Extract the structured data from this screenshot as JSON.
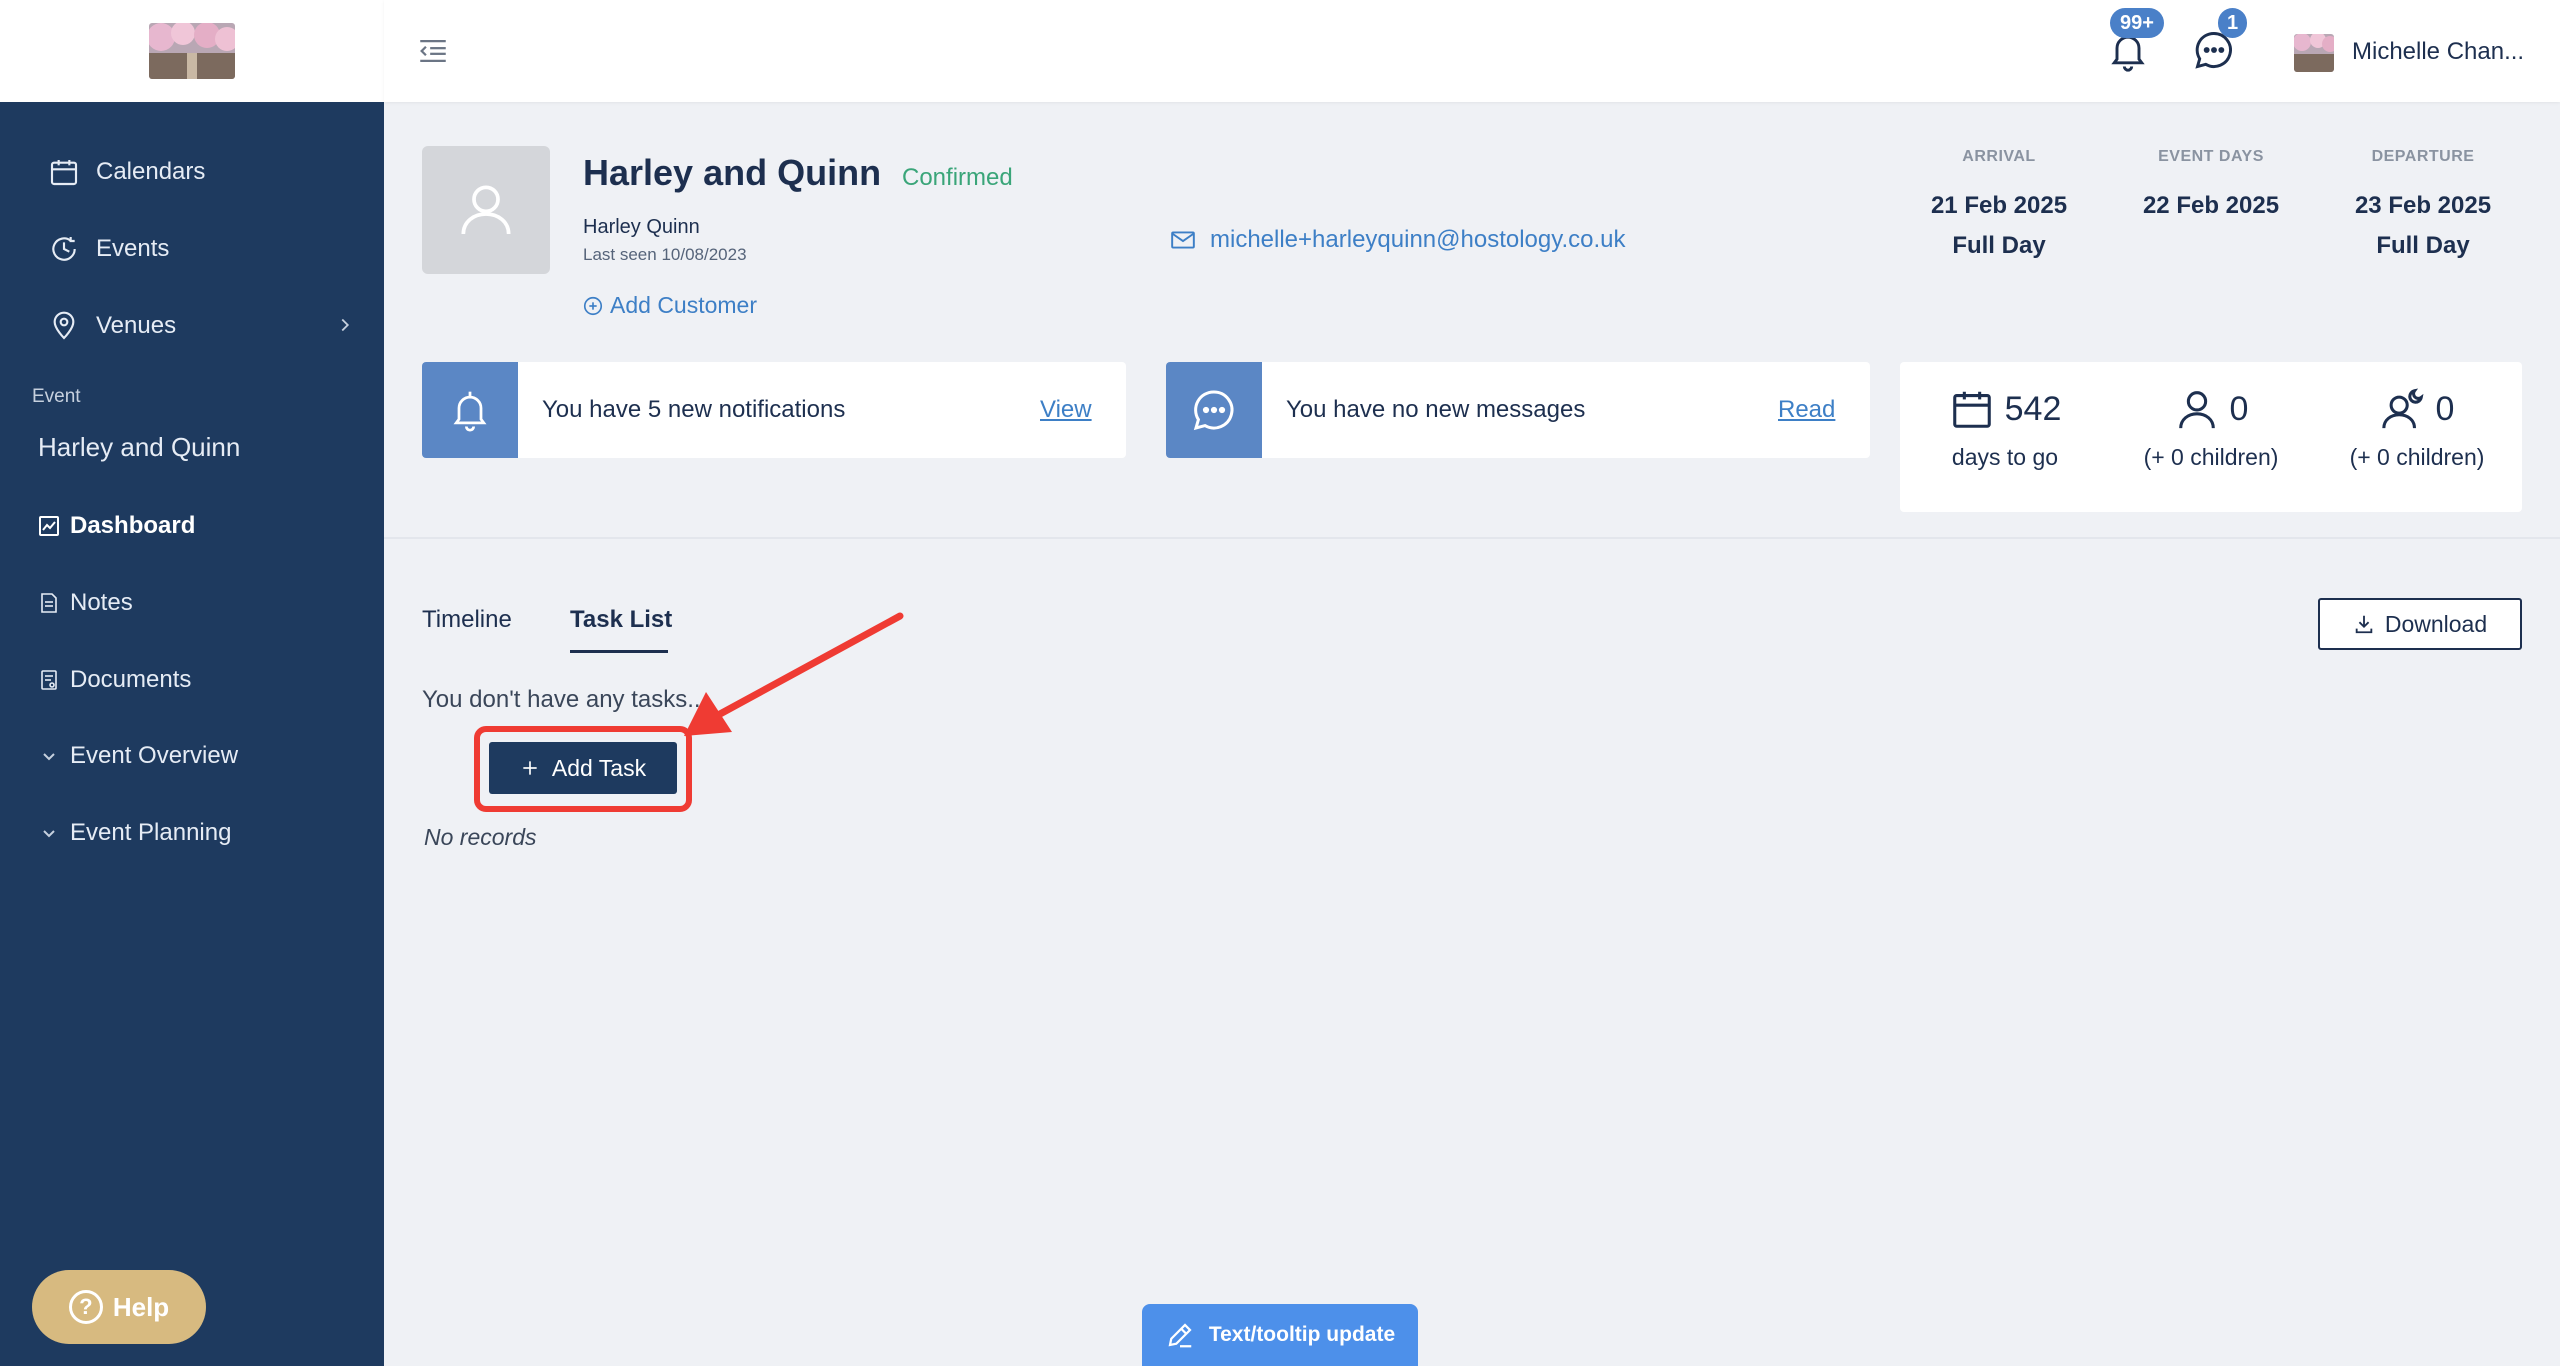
{
  "topbar": {
    "notif_badge": "99+",
    "msg_badge": "1",
    "user_name": "Michelle Chan..."
  },
  "sidebar": {
    "nav": [
      {
        "label": "Calendars",
        "icon": "calendar-icon"
      },
      {
        "label": "Events",
        "icon": "events-clock-icon"
      },
      {
        "label": "Venues",
        "icon": "location-pin-icon"
      }
    ],
    "section_label": "Event",
    "event_name": "Harley and Quinn",
    "event_nav": [
      {
        "label": "Dashboard",
        "icon": "chart-icon",
        "active": true
      },
      {
        "label": "Notes",
        "icon": "note-icon"
      },
      {
        "label": "Documents",
        "icon": "document-icon"
      },
      {
        "label": "Event Overview",
        "icon": "chevron-down-icon"
      },
      {
        "label": "Event Planning",
        "icon": "chevron-down-icon"
      }
    ],
    "help_label": "Help"
  },
  "event": {
    "title": "Harley and Quinn",
    "status": "Confirmed",
    "customer_name": "Harley Quinn",
    "last_seen": "Last seen 10/08/2023",
    "add_customer": "Add Customer",
    "email": "michelle+harleyquinn@hostology.co.uk",
    "arrival_label": "ARRIVAL",
    "arrival_date": "21 Feb 2025",
    "arrival_sub": "Full Day",
    "event_days_label": "EVENT DAYS",
    "event_days_date": "22 Feb 2025",
    "departure_label": "DEPARTURE",
    "departure_date": "23 Feb 2025",
    "departure_sub": "Full Day"
  },
  "cards": {
    "notifications_text": "You have 5 new notifications",
    "notifications_link": "View",
    "messages_text": "You have no new messages",
    "messages_link": "Read"
  },
  "stats": {
    "days_value": "542",
    "days_caption": "days to go",
    "guests_value": "0",
    "guests_caption": "(+ 0 children)",
    "overnight_value": "0",
    "overnight_caption": "(+ 0 children)"
  },
  "tabs": {
    "timeline": "Timeline",
    "task_list": "Task List",
    "download": "Download"
  },
  "tasks": {
    "empty_message": "You don't have any tasks...",
    "add_task": "Add Task",
    "no_records": "No records"
  },
  "tooltip_button": "Text/tooltip update",
  "colors": {
    "sidebar": "#1e3a5f",
    "accent": "#3d7fc6",
    "confirmed": "#3aa579",
    "highlight": "#ef3b33",
    "help": "#d7ba80"
  }
}
